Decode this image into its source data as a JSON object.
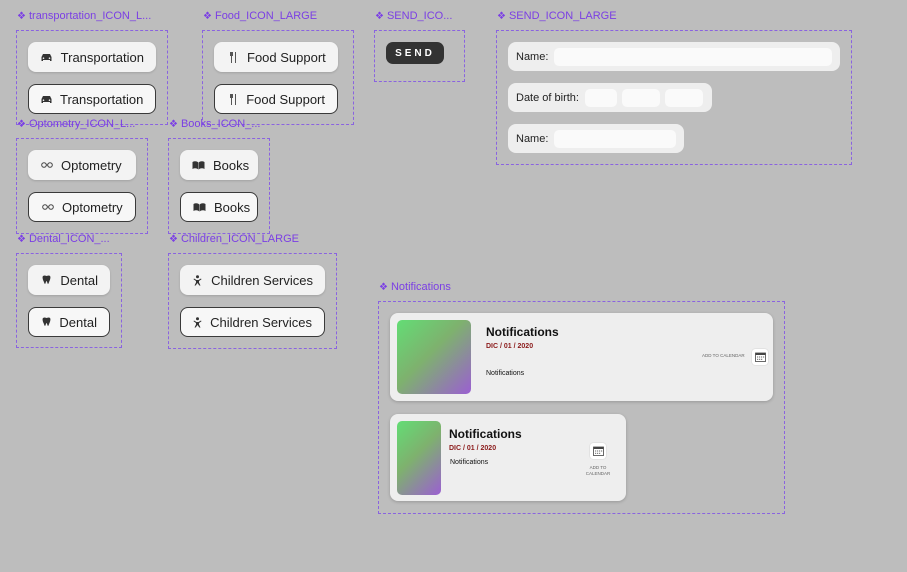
{
  "frames": {
    "transportation": {
      "label": "transportation_ICON_L...",
      "items": [
        "Transportation",
        "Transportation"
      ]
    },
    "food": {
      "label": "Food_ICON_LARGE",
      "items": [
        "Food Support",
        "Food Support"
      ]
    },
    "send_small": {
      "label": "SEND_ICO...",
      "button": "SEND"
    },
    "send_large": {
      "label": "SEND_ICON_LARGE"
    },
    "optometry": {
      "label": "Optometry_ICON_L...",
      "items": [
        "Optometry",
        "Optometry"
      ]
    },
    "books": {
      "label": "Books_ICON_...",
      "items": [
        "Books",
        "Books"
      ]
    },
    "dental": {
      "label": "Dental_ICON_...",
      "items": [
        "Dental",
        "Dental"
      ]
    },
    "children": {
      "label": "Children_ICON_LARGE",
      "items": [
        "Children Services",
        "Children Services"
      ]
    },
    "notifications": {
      "label": "Notifications"
    }
  },
  "form": {
    "name_label": "Name:",
    "dob_label": "Date of birth:",
    "name2_label": "Name:"
  },
  "notifications": [
    {
      "title": "Notifications",
      "date": "DIC / 01 / 2020",
      "text": "Notifications",
      "calendar_label": "ADD TO CALENDAR"
    },
    {
      "title": "Notifications",
      "date": "DIC / 01 / 2020",
      "text": "Notifications",
      "calendar_label": "ADD TO CALENDAR"
    }
  ],
  "icons": {
    "transportation": "car-icon",
    "food": "utensils-icon",
    "optometry": "glasses-icon",
    "books": "book-icon",
    "dental": "tooth-icon",
    "children": "child-icon",
    "calendar": "calendar-icon"
  },
  "colors": {
    "frame_accent": "#7b3fe4",
    "send_button": "#333333",
    "date_text": "#8b1a1a"
  }
}
